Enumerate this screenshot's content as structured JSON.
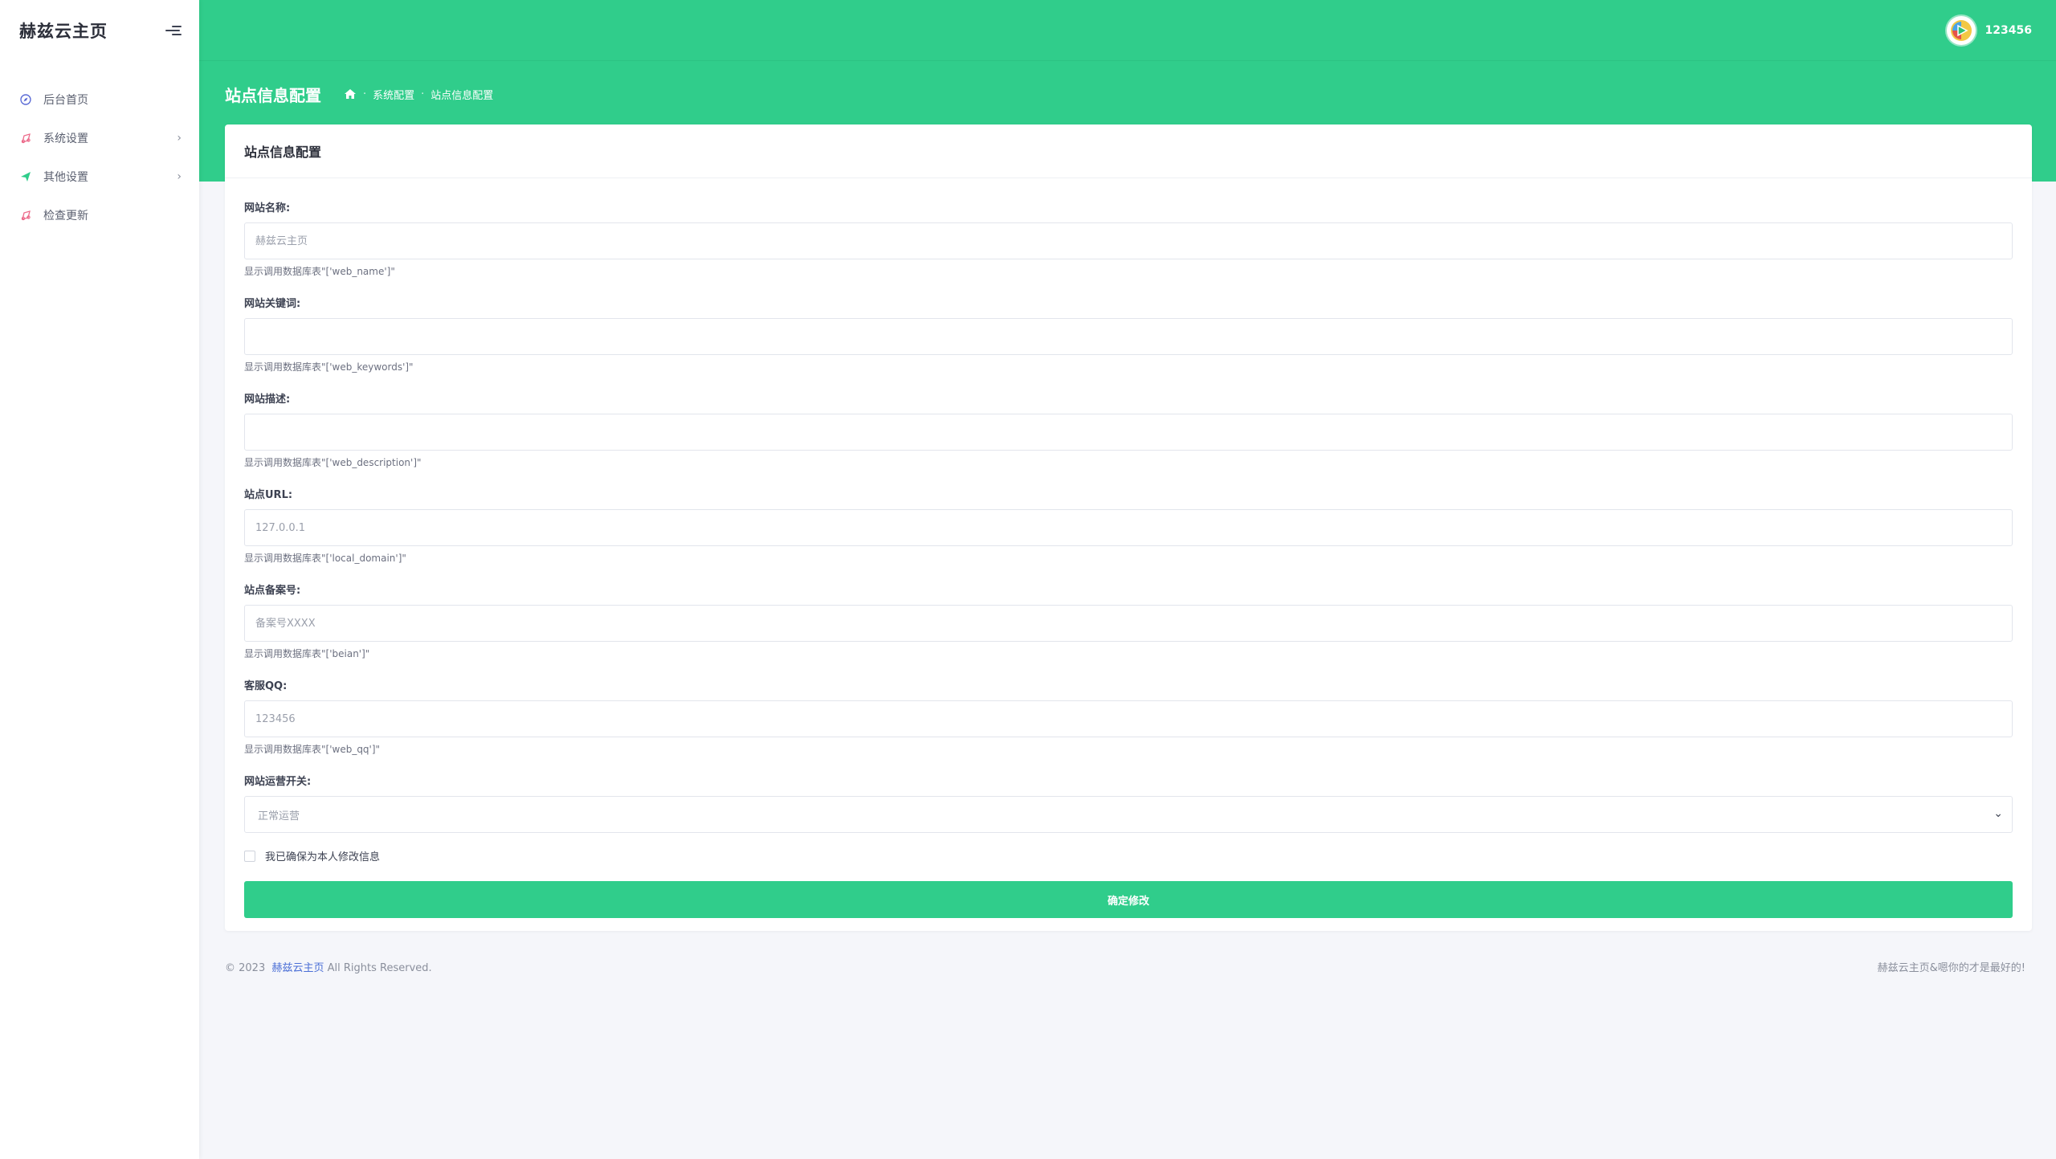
{
  "sidebar": {
    "brand": "赫兹云主页",
    "items": [
      {
        "label": "后台首页",
        "icon": "dashboard-icon",
        "color": "#5b6bd6",
        "has_children": false
      },
      {
        "label": "系统设置",
        "icon": "settings-icon",
        "color": "#ec6a8a",
        "has_children": true
      },
      {
        "label": "其他设置",
        "icon": "send-icon",
        "color": "#30cd8b",
        "has_children": true
      },
      {
        "label": "检查更新",
        "icon": "update-icon",
        "color": "#ec6a8a",
        "has_children": false
      }
    ]
  },
  "header": {
    "username": "123456",
    "avatar_icon": "play-logo-icon"
  },
  "page": {
    "title": "站点信息配置",
    "breadcrumb": [
      "系统配置",
      "站点信息配置"
    ]
  },
  "card": {
    "title": "站点信息配置",
    "fields": [
      {
        "label": "网站名称:",
        "value": "",
        "placeholder": "赫兹云主页",
        "help": "显示调用数据库表\"['web_name']\""
      },
      {
        "label": "网站关键词:",
        "value": "",
        "placeholder": "",
        "help": "显示调用数据库表\"['web_keywords']\""
      },
      {
        "label": "网站描述:",
        "value": "",
        "placeholder": "",
        "help": "显示调用数据库表\"['web_description']\""
      },
      {
        "label": "站点URL:",
        "value": "",
        "placeholder": "127.0.0.1",
        "help": "显示调用数据库表\"['local_domain']\""
      },
      {
        "label": "站点备案号:",
        "value": "",
        "placeholder": "备案号XXXX",
        "help": "显示调用数据库表\"['beian']\""
      },
      {
        "label": "客服QQ:",
        "value": "",
        "placeholder": "123456",
        "help": "显示调用数据库表\"['web_qq']\""
      }
    ],
    "switch": {
      "label": "网站运营开关:",
      "selected": "正常运营"
    },
    "confirm_label": "我已确保为本人修改信息",
    "submit_label": "确定修改"
  },
  "footer": {
    "copyright_prefix": "© 2023",
    "site_link": "赫兹云主页",
    "rights": "All Rights Reserved.",
    "right_text": "赫兹云主页&嗯你的才是最好的!"
  },
  "colors": {
    "accent": "#30cd8b",
    "link": "#4b6fd6"
  }
}
